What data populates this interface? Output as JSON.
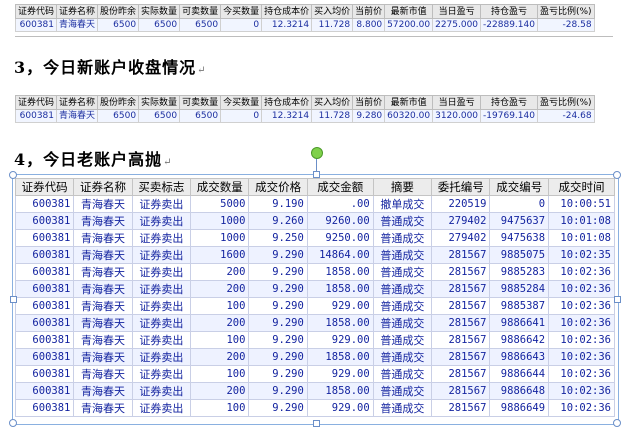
{
  "table1": {
    "headers": [
      "证券代码",
      "证券名称",
      "股份昨余",
      "实际数量",
      "可卖数量",
      "今买数量",
      "持仓成本价",
      "买入均价",
      "当前价",
      "最新市值",
      "当日盈亏",
      "持仓盈亏",
      "盈亏比例(%)"
    ],
    "row": [
      "600381",
      "青海春天",
      "6500",
      "6500",
      "6500",
      "0",
      "12.3214",
      "11.728",
      "8.800",
      "57200.00",
      "2275.000",
      "-22889.140",
      "-28.58"
    ]
  },
  "section3": {
    "title": "3，今日新账户收盘情况"
  },
  "table2": {
    "headers": [
      "证券代码",
      "证券名称",
      "股份昨余",
      "实际数量",
      "可卖数量",
      "今买数量",
      "持仓成本价",
      "买入均价",
      "当前价",
      "最新市值",
      "当日盈亏",
      "持仓盈亏",
      "盈亏比例(%)"
    ],
    "row": [
      "600381",
      "青海春天",
      "6500",
      "6500",
      "6500",
      "0",
      "12.3214",
      "11.728",
      "9.280",
      "60320.00",
      "3120.000",
      "-19769.140",
      "-24.68"
    ]
  },
  "section4": {
    "title": "4，今日老账户高抛"
  },
  "table3": {
    "headers": [
      "证券代码",
      "证券名称",
      "买卖标志",
      "成交数量",
      "成交价格",
      "成交金额",
      "摘要",
      "委托编号",
      "成交编号",
      "成交时间"
    ],
    "rows": [
      [
        "600381",
        "青海春天",
        "证券卖出",
        "5000",
        "9.190",
        ".00",
        "撤单成交",
        "220519",
        "0",
        "10:00:51"
      ],
      [
        "600381",
        "青海春天",
        "证券卖出",
        "1000",
        "9.260",
        "9260.00",
        "普通成交",
        "279402",
        "9475637",
        "10:01:08"
      ],
      [
        "600381",
        "青海春天",
        "证券卖出",
        "1000",
        "9.250",
        "9250.00",
        "普通成交",
        "279402",
        "9475638",
        "10:01:08"
      ],
      [
        "600381",
        "青海春天",
        "证券卖出",
        "1600",
        "9.290",
        "14864.00",
        "普通成交",
        "281567",
        "9885075",
        "10:02:35"
      ],
      [
        "600381",
        "青海春天",
        "证券卖出",
        "200",
        "9.290",
        "1858.00",
        "普通成交",
        "281567",
        "9885283",
        "10:02:36"
      ],
      [
        "600381",
        "青海春天",
        "证券卖出",
        "200",
        "9.290",
        "1858.00",
        "普通成交",
        "281567",
        "9885284",
        "10:02:36"
      ],
      [
        "600381",
        "青海春天",
        "证券卖出",
        "100",
        "9.290",
        "929.00",
        "普通成交",
        "281567",
        "9885387",
        "10:02:36"
      ],
      [
        "600381",
        "青海春天",
        "证券卖出",
        "200",
        "9.290",
        "1858.00",
        "普通成交",
        "281567",
        "9886641",
        "10:02:36"
      ],
      [
        "600381",
        "青海春天",
        "证券卖出",
        "100",
        "9.290",
        "929.00",
        "普通成交",
        "281567",
        "9886642",
        "10:02:36"
      ],
      [
        "600381",
        "青海春天",
        "证券卖出",
        "200",
        "9.290",
        "1858.00",
        "普通成交",
        "281567",
        "9886643",
        "10:02:36"
      ],
      [
        "600381",
        "青海春天",
        "证券卖出",
        "100",
        "9.290",
        "929.00",
        "普通成交",
        "281567",
        "9886644",
        "10:02:36"
      ],
      [
        "600381",
        "青海春天",
        "证券卖出",
        "200",
        "9.290",
        "1858.00",
        "普通成交",
        "281567",
        "9886648",
        "10:02:36"
      ],
      [
        "600381",
        "青海春天",
        "证券卖出",
        "100",
        "9.290",
        "929.00",
        "普通成交",
        "281567",
        "9886649",
        "10:02:36"
      ]
    ]
  },
  "para_mark": "↵"
}
